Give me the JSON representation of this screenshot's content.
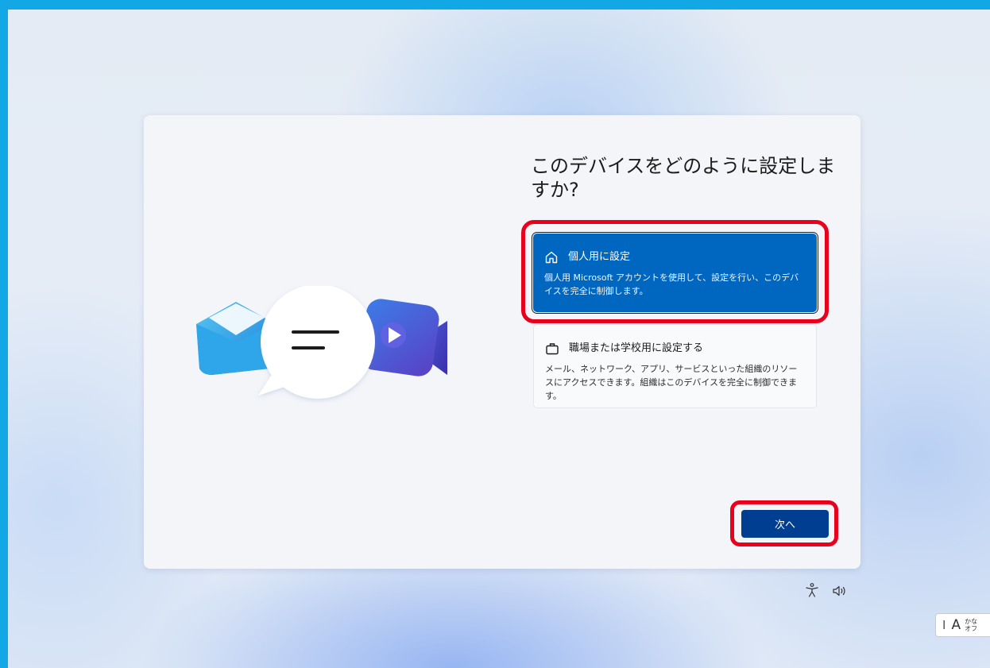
{
  "setup": {
    "title": "このデバイスをどのように設定しますか?",
    "options": [
      {
        "id": "personal",
        "icon": "home-icon",
        "title": "個人用に設定",
        "description": "個人用 Microsoft アカウントを使用して、設定を行い、このデバイスを完全に制御します。",
        "selected": true
      },
      {
        "id": "work",
        "icon": "briefcase-icon",
        "title": "職場または学校用に設定する",
        "description": "メール、ネットワーク、アプリ、サービスといった組織のリソースにアクセスできます。組織はこのデバイスを完全に制御できます。",
        "selected": false
      }
    ],
    "next_label": "次へ"
  },
  "illustration": {
    "icons": [
      "mail-icon",
      "chat-bubble-icon",
      "video-camera-icon"
    ]
  },
  "footer": {
    "icons": [
      "accessibility-icon",
      "volume-icon"
    ]
  },
  "ime": {
    "letter": "A",
    "mode_line1": "かな",
    "mode_line2": "オフ"
  },
  "colors": {
    "frame": "#12a8e6",
    "selected_option": "#0067c0",
    "next_button": "#003e92",
    "highlight": "#e8001c"
  }
}
